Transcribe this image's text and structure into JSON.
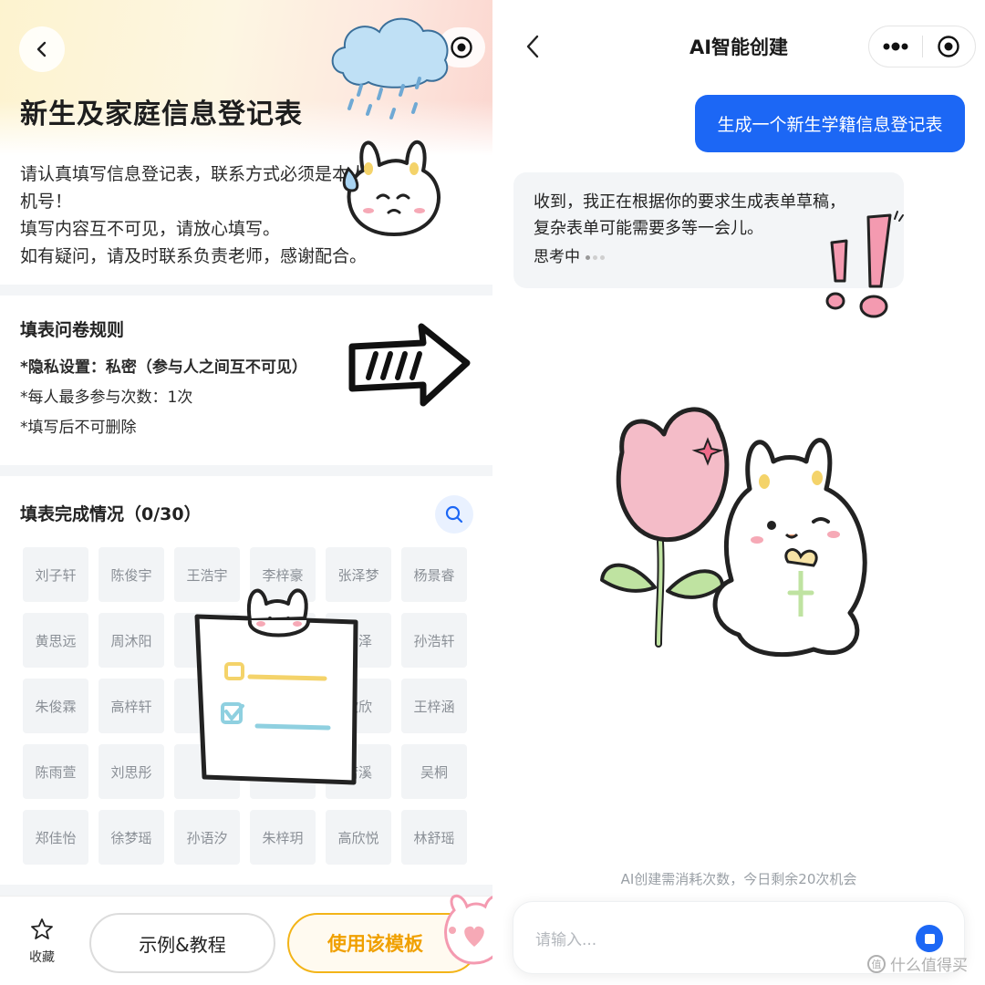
{
  "left": {
    "title": "新生及家庭信息登记表",
    "intro": [
      "请认真填写信息登记表，联系方式必须是本人的手",
      "机号！",
      "填写内容互不可见，请放心填写。",
      "如有疑问，请及时联系负责老师，感谢配合。"
    ],
    "rules": {
      "title": "填表问卷规则",
      "items": [
        "*隐私设置：私密（参与人之间互不可见）",
        "*每人最多参与次数：1次",
        "*填写后不可删除"
      ]
    },
    "progress": {
      "title": "填表完成情况（0/30）",
      "names": [
        "刘子轩",
        "陈俊宇",
        "王浩宇",
        "李梓豪",
        "张泽梦",
        "杨景睿",
        "黄思远",
        "周沐阳",
        "",
        "",
        "铭泽",
        "孙浩轩",
        "朱俊霖",
        "高梓轩",
        "",
        "",
        "欣欣",
        "王梓涵",
        "陈雨萱",
        "刘思彤",
        "",
        "",
        "若溪",
        "吴桐",
        "郑佳怡",
        "徐梦瑶",
        "孙语汐",
        "朱梓玥",
        "高欣悦",
        "林舒瑶"
      ]
    },
    "bottom": {
      "favorite_label": "收藏",
      "example_label": "示例&教程",
      "use_label": "使用该模板"
    }
  },
  "right": {
    "title": "AI智能创建",
    "user_message": "生成一个新生学籍信息登记表",
    "ai_message_lines": [
      "收到，我正在根据你的要求生成表单草稿，",
      "复杂表单可能需要多等一会儿。"
    ],
    "thinking_label": "思考中",
    "quota_note": "AI创建需消耗次数，今日剩余20次机会",
    "input_placeholder": "请输入..."
  },
  "watermark": "什么值得买",
  "colors": {
    "accent_blue": "#1c67f5",
    "accent_orange": "#f0a000",
    "chip_bg": "#f2f4f6",
    "chip_text": "#8a8f96"
  },
  "icons": [
    "back-chevron-icon",
    "target-icon",
    "more-dots-icon",
    "search-icon",
    "star-icon",
    "stop-icon"
  ]
}
